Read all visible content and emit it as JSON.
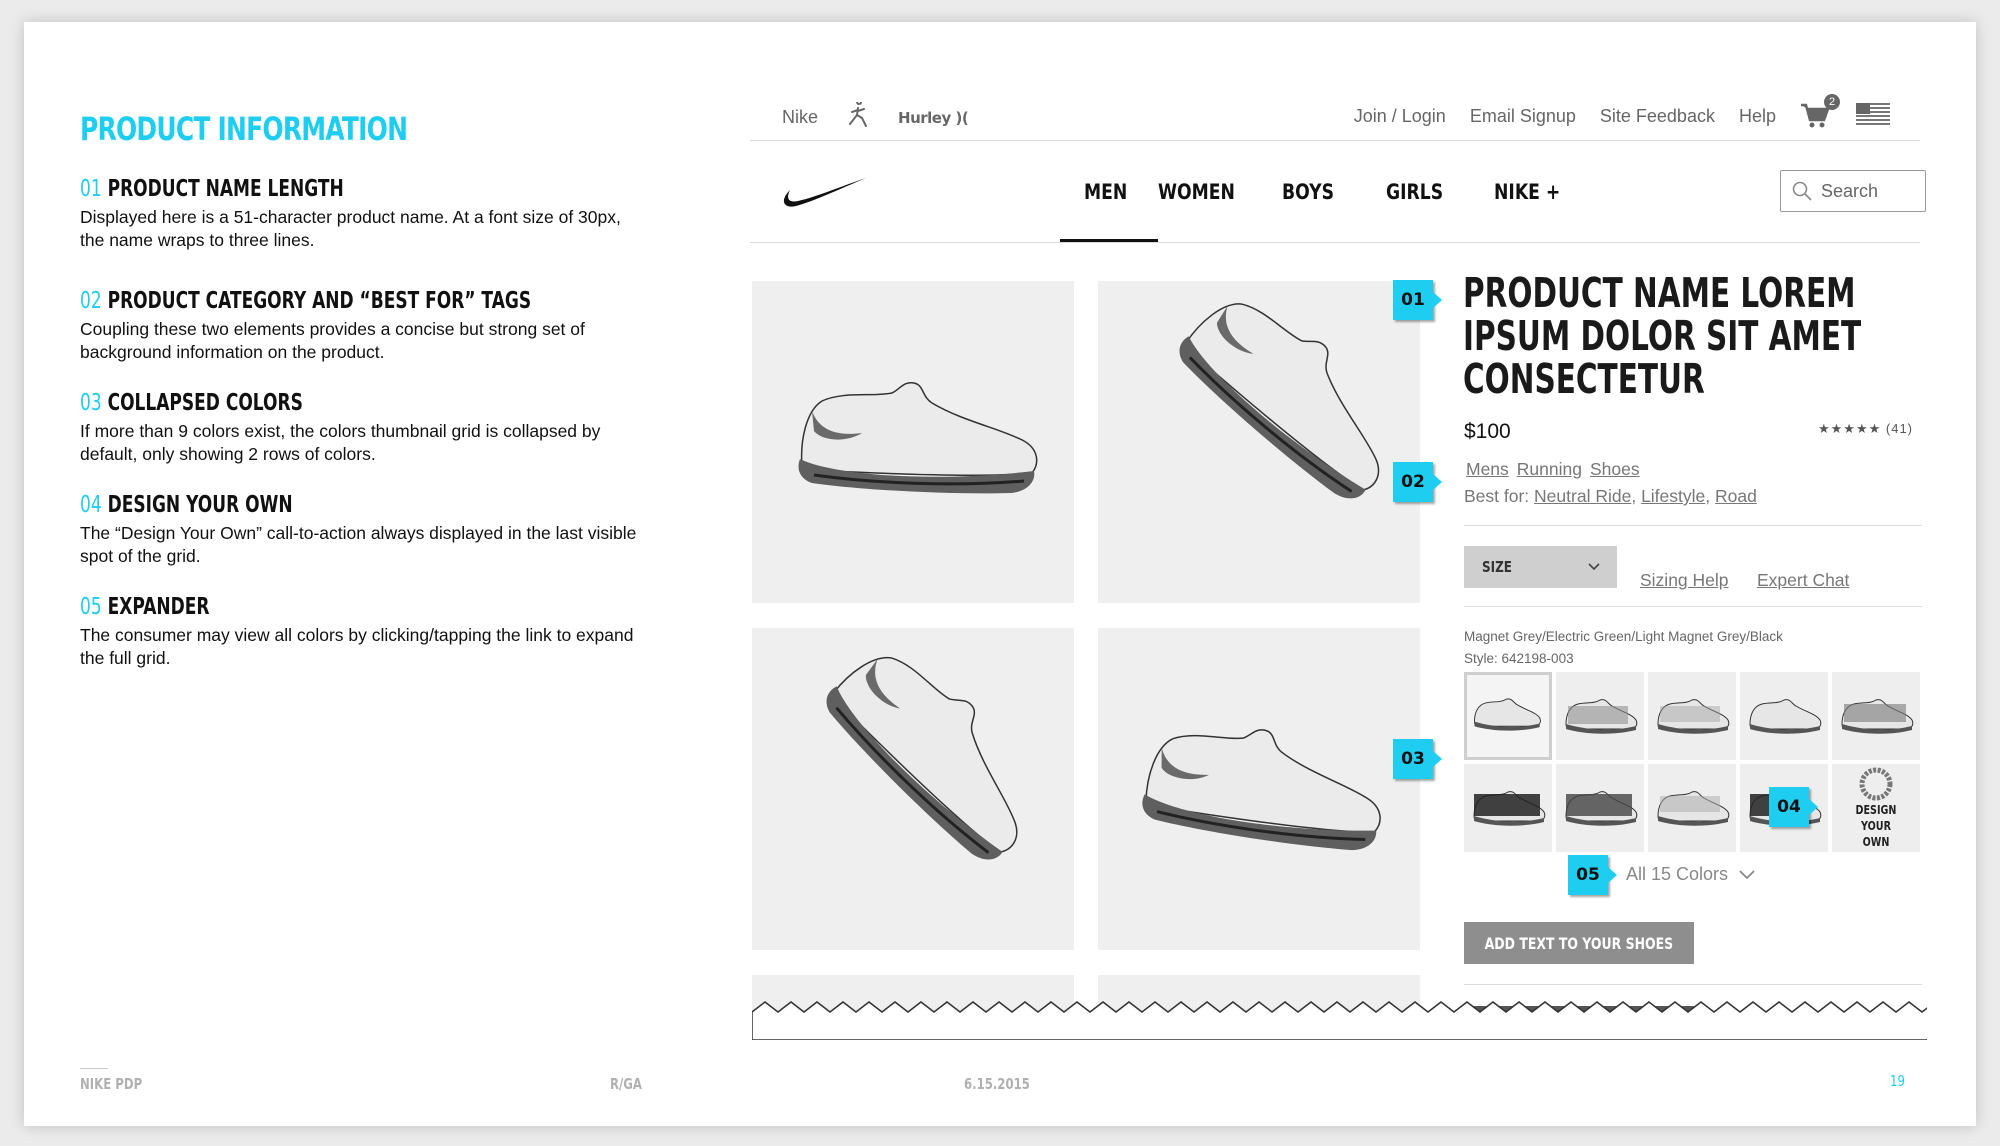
{
  "left_panel": {
    "title": "PRODUCT INFORMATION",
    "notes": [
      {
        "num": "01",
        "heading": "PRODUCT NAME LENGTH",
        "body": "Displayed here is a 51-character product name. At a font size of 30px, the name wraps to three lines."
      },
      {
        "num": "02",
        "heading": "PRODUCT CATEGORY AND “BEST FOR” TAGS",
        "body": "Coupling these two elements provides a concise but strong set of background information on the product."
      },
      {
        "num": "03",
        "heading": "COLLAPSED COLORS",
        "body": "If more than 9 colors exist, the colors thumbnail grid is collapsed by default, only showing 2 rows of colors."
      },
      {
        "num": "04",
        "heading": "DESIGN YOUR OWN",
        "body": "The “Design Your Own” call-to-action always displayed in the last visible spot of the grid."
      },
      {
        "num": "05",
        "heading": "EXPANDER",
        "body": "The consumer may view all colors by clicking/tapping the link to expand the full grid."
      }
    ]
  },
  "footer": {
    "project": "NIKE PDP",
    "agency": "R/GA",
    "date": "6.15.2015",
    "page": "19"
  },
  "util_bar": {
    "brands": [
      "Nike",
      "Hurley"
    ],
    "links": [
      "Join / Login",
      "Email Signup",
      "Site Feedback",
      "Help"
    ],
    "cart_count": "2"
  },
  "nav": {
    "items": [
      "MEN",
      "WOMEN",
      "BOYS",
      "GIRLS",
      "NIKE +"
    ],
    "search_label": "Search"
  },
  "annotations": [
    "01",
    "02",
    "03",
    "04",
    "05"
  ],
  "product": {
    "name": "PRODUCT NAME LOREM IPSUM DOLOR SIT AMET CONSECTETUR",
    "price": "$100",
    "rating": "★★★★★ (41)",
    "categories": [
      "Mens",
      "Running",
      "Shoes"
    ],
    "best_for_label": "Best for:",
    "best_for": [
      "Neutral Ride",
      "Lifestyle",
      "Road"
    ],
    "size_label": "SIZE",
    "sizing_help": "Sizing Help",
    "expert_chat": "Expert Chat",
    "color_name": "Magnet Grey/Electric Green/Light Magnet Grey/Black",
    "style": "Style: 642198-003",
    "design_your_own": "DESIGN YOUR OWN",
    "all_colors": "All 15 Colors",
    "add_text_cta": "ADD TEXT TO YOUR SHOES"
  },
  "colors": {
    "accent": "#1ecdf0",
    "tile_bg": "#efefef",
    "cta_bg": "#8e8e8e"
  }
}
